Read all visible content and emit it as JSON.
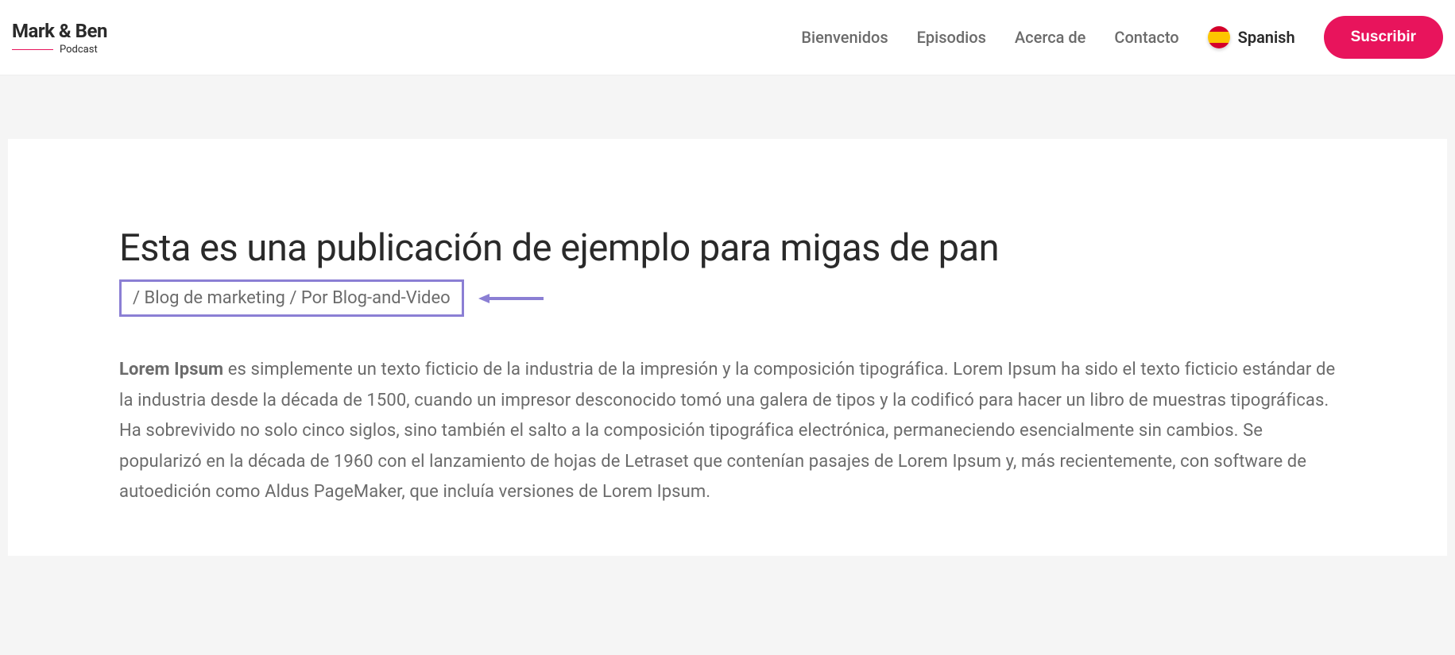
{
  "logo": {
    "title": "Mark & Ben",
    "subtitle": "Podcast"
  },
  "nav": {
    "items": [
      {
        "label": "Bienvenidos"
      },
      {
        "label": "Episodios"
      },
      {
        "label": "Acerca de"
      },
      {
        "label": "Contacto"
      }
    ],
    "language": "Spanish",
    "subscribe": "Suscribir"
  },
  "article": {
    "title": "Esta es una publicación de ejemplo para migas de pan",
    "breadcrumb": {
      "sep1": "/ ",
      "category": "Blog de marketing",
      "sep2": " / Por ",
      "author": "Blog-and-Video"
    },
    "body": {
      "strong": "Lorem Ipsum",
      "text": " es simplemente un texto ficticio de la industria de la impresión y la composición tipográfica. Lorem Ipsum ha sido el texto ficticio estándar de la industria desde la década de 1500, cuando un impresor desconocido tomó una galera de tipos y la codificó para hacer un libro de muestras tipográficas. Ha sobrevivido no solo cinco siglos, sino también el salto a la composición tipográfica electrónica, permaneciendo esencialmente sin cambios. Se popularizó en la década de 1960 con el lanzamiento de hojas de Letraset que contenían pasajes de Lorem Ipsum y, más recientemente, con software de autoedición como Aldus PageMaker, que incluía versiones de Lorem Ipsum."
    }
  }
}
